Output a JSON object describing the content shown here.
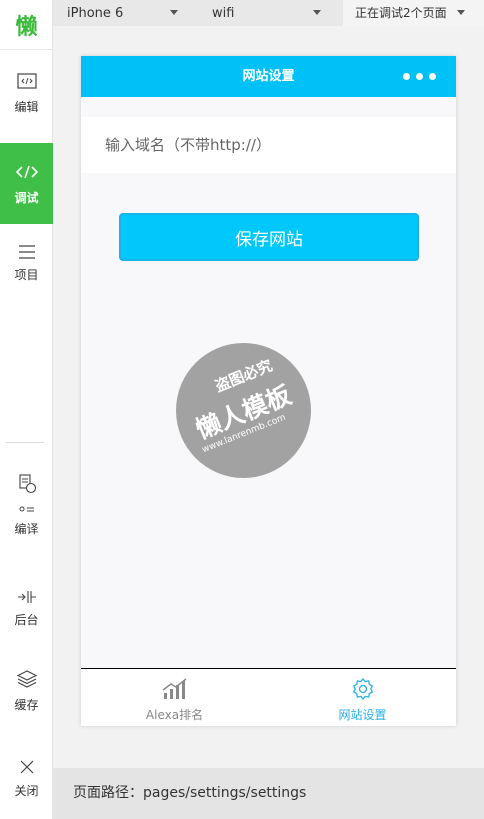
{
  "sidebar": {
    "logo_text": "懒",
    "items": [
      {
        "label": "编辑",
        "icon": "code-box-icon"
      },
      {
        "label": "调试",
        "icon": "code-icon",
        "active": true
      },
      {
        "label": "项目",
        "icon": "menu-icon"
      },
      {
        "label": "编译",
        "icon": "compile-icon"
      },
      {
        "label": "后台",
        "icon": "background-icon"
      },
      {
        "label": "缓存",
        "icon": "layers-icon"
      },
      {
        "label": "关闭",
        "icon": "close-icon"
      }
    ]
  },
  "topbar": {
    "device": "iPhone 6",
    "network": "wifi",
    "debug_pages": "正在调试2个页面"
  },
  "phone": {
    "nav_title": "网站设置",
    "input_placeholder": "输入域名（不带http://）",
    "save_button": "保存网站",
    "watermark": {
      "line1": "盗图必究",
      "line2": "懒人模板",
      "line3": "www.lanrenmb.com"
    },
    "tabs": [
      {
        "label": "Alexa排名",
        "icon": "bar-chart-icon",
        "color": "#888888"
      },
      {
        "label": "网站设置",
        "icon": "settings-icon",
        "color": "#2ab0e8",
        "active": true
      }
    ]
  },
  "footer": {
    "path_label": "页面路径：pages/settings/settings"
  },
  "colors": {
    "accent_green": "#3fbf48",
    "navbar_blue": "#00c0f8",
    "button_blue": "#00c8fa",
    "tab_active": "#2ab0e8"
  }
}
